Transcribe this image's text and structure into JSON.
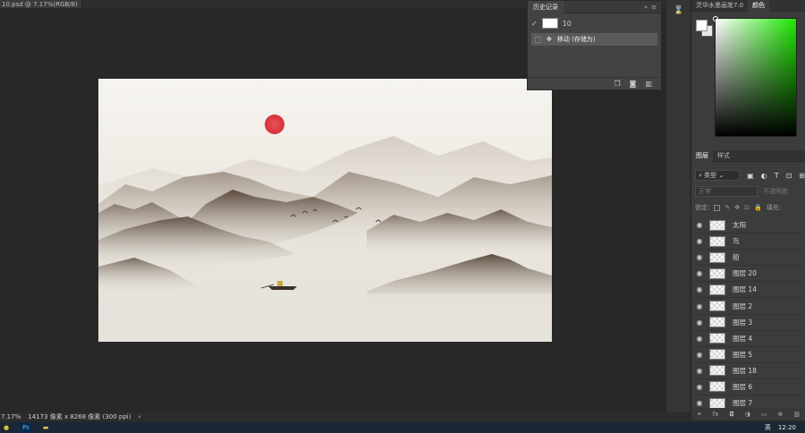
{
  "document": {
    "tab_title": "10.psd @ 7.17%(RGB/8)",
    "close_glyph": "×"
  },
  "history_panel": {
    "tab_label": "历史记录",
    "snapshot_name": "10",
    "states": [
      {
        "label": "移动 (存储为)"
      }
    ],
    "footer_icons": [
      "new-doc-from-state-icon",
      "camera-icon",
      "trash-icon"
    ]
  },
  "right_panel": {
    "tabs": [
      {
        "label": "灵华水墨画笔7.0"
      },
      {
        "label": "颜色"
      }
    ],
    "color": {
      "foreground": "#ffffff",
      "background": "#e8e8e8",
      "picker_hue": "#1de800"
    },
    "layers_tabs": [
      {
        "label": "图层"
      },
      {
        "label": "样式"
      }
    ],
    "kind_filter": "类型",
    "blend_mode": "正常",
    "opacity_label": "不透明度:",
    "lock_label": "锁定:",
    "fill_label": "填充:",
    "layers": [
      {
        "name": "太阳"
      },
      {
        "name": "鸟"
      },
      {
        "name": "船"
      },
      {
        "name": "图层 20"
      },
      {
        "name": "图层 14"
      },
      {
        "name": "图层 2"
      },
      {
        "name": "图层 3"
      },
      {
        "name": "图层 4"
      },
      {
        "name": "图层 5"
      },
      {
        "name": "图层 18"
      },
      {
        "name": "图层 6"
      },
      {
        "name": "图层 7"
      }
    ]
  },
  "status_bar": {
    "zoom": "7.17%",
    "doc_info": "14173 像素 x 8268 像素 (300 ppi)"
  },
  "taskbar": {
    "ime": "英",
    "time": "12:20"
  },
  "colors": {
    "sun": "#e03a40",
    "mountain_dark": "#5a4a3e",
    "mountain_light": "#a89c90",
    "paper": "#ece9e2"
  }
}
